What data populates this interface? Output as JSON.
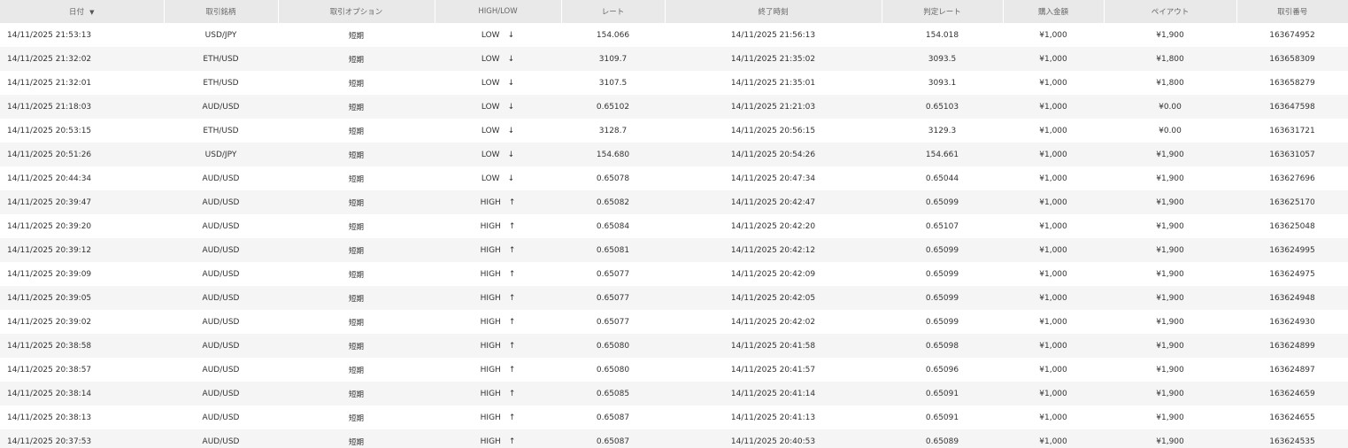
{
  "table": {
    "headers": {
      "date": "日付",
      "symbol": "取引銘柄",
      "option": "取引オプション",
      "direction": "HIGH/LOW",
      "rate": "レート",
      "end_time": "終了時刻",
      "judge_rate": "判定レート",
      "amount": "購入金額",
      "payout": "ペイアウト",
      "trade_no": "取引番号"
    },
    "sort_icon": "caret-down-icon",
    "colors": {
      "low": "#d9263c",
      "high": "#3fb62e",
      "payout_win": "#3fb62e",
      "payout_loss": "#d9263c",
      "header_bg": "#e9e9e9",
      "row_alt_bg": "#f5f5f5"
    },
    "rows": [
      {
        "date": "14/11/2025 21:53:13",
        "symbol": "USD/JPY",
        "option": "短期",
        "direction": "LOW",
        "arrow": "↓",
        "rate": "154.066",
        "end_time": "14/11/2025 21:56:13",
        "judge_rate": "154.018",
        "amount": "¥1,000",
        "payout": "¥1,900",
        "result": "win",
        "trade_no": "163674952"
      },
      {
        "date": "14/11/2025 21:32:02",
        "symbol": "ETH/USD",
        "option": "短期",
        "direction": "LOW",
        "arrow": "↓",
        "rate": "3109.7",
        "end_time": "14/11/2025 21:35:02",
        "judge_rate": "3093.5",
        "amount": "¥1,000",
        "payout": "¥1,800",
        "result": "win",
        "trade_no": "163658309"
      },
      {
        "date": "14/11/2025 21:32:01",
        "symbol": "ETH/USD",
        "option": "短期",
        "direction": "LOW",
        "arrow": "↓",
        "rate": "3107.5",
        "end_time": "14/11/2025 21:35:01",
        "judge_rate": "3093.1",
        "amount": "¥1,000",
        "payout": "¥1,800",
        "result": "win",
        "trade_no": "163658279"
      },
      {
        "date": "14/11/2025 21:18:03",
        "symbol": "AUD/USD",
        "option": "短期",
        "direction": "LOW",
        "arrow": "↓",
        "rate": "0.65102",
        "end_time": "14/11/2025 21:21:03",
        "judge_rate": "0.65103",
        "amount": "¥1,000",
        "payout": "¥0.00",
        "result": "loss",
        "trade_no": "163647598"
      },
      {
        "date": "14/11/2025 20:53:15",
        "symbol": "ETH/USD",
        "option": "短期",
        "direction": "LOW",
        "arrow": "↓",
        "rate": "3128.7",
        "end_time": "14/11/2025 20:56:15",
        "judge_rate": "3129.3",
        "amount": "¥1,000",
        "payout": "¥0.00",
        "result": "loss",
        "trade_no": "163631721"
      },
      {
        "date": "14/11/2025 20:51:26",
        "symbol": "USD/JPY",
        "option": "短期",
        "direction": "LOW",
        "arrow": "↓",
        "rate": "154.680",
        "end_time": "14/11/2025 20:54:26",
        "judge_rate": "154.661",
        "amount": "¥1,000",
        "payout": "¥1,900",
        "result": "win",
        "trade_no": "163631057"
      },
      {
        "date": "14/11/2025 20:44:34",
        "symbol": "AUD/USD",
        "option": "短期",
        "direction": "LOW",
        "arrow": "↓",
        "rate": "0.65078",
        "end_time": "14/11/2025 20:47:34",
        "judge_rate": "0.65044",
        "amount": "¥1,000",
        "payout": "¥1,900",
        "result": "win",
        "trade_no": "163627696"
      },
      {
        "date": "14/11/2025 20:39:47",
        "symbol": "AUD/USD",
        "option": "短期",
        "direction": "HIGH",
        "arrow": "↑",
        "rate": "0.65082",
        "end_time": "14/11/2025 20:42:47",
        "judge_rate": "0.65099",
        "amount": "¥1,000",
        "payout": "¥1,900",
        "result": "win",
        "trade_no": "163625170"
      },
      {
        "date": "14/11/2025 20:39:20",
        "symbol": "AUD/USD",
        "option": "短期",
        "direction": "HIGH",
        "arrow": "↑",
        "rate": "0.65084",
        "end_time": "14/11/2025 20:42:20",
        "judge_rate": "0.65107",
        "amount": "¥1,000",
        "payout": "¥1,900",
        "result": "win",
        "trade_no": "163625048"
      },
      {
        "date": "14/11/2025 20:39:12",
        "symbol": "AUD/USD",
        "option": "短期",
        "direction": "HIGH",
        "arrow": "↑",
        "rate": "0.65081",
        "end_time": "14/11/2025 20:42:12",
        "judge_rate": "0.65099",
        "amount": "¥1,000",
        "payout": "¥1,900",
        "result": "win",
        "trade_no": "163624995"
      },
      {
        "date": "14/11/2025 20:39:09",
        "symbol": "AUD/USD",
        "option": "短期",
        "direction": "HIGH",
        "arrow": "↑",
        "rate": "0.65077",
        "end_time": "14/11/2025 20:42:09",
        "judge_rate": "0.65099",
        "amount": "¥1,000",
        "payout": "¥1,900",
        "result": "win",
        "trade_no": "163624975"
      },
      {
        "date": "14/11/2025 20:39:05",
        "symbol": "AUD/USD",
        "option": "短期",
        "direction": "HIGH",
        "arrow": "↑",
        "rate": "0.65077",
        "end_time": "14/11/2025 20:42:05",
        "judge_rate": "0.65099",
        "amount": "¥1,000",
        "payout": "¥1,900",
        "result": "win",
        "trade_no": "163624948"
      },
      {
        "date": "14/11/2025 20:39:02",
        "symbol": "AUD/USD",
        "option": "短期",
        "direction": "HIGH",
        "arrow": "↑",
        "rate": "0.65077",
        "end_time": "14/11/2025 20:42:02",
        "judge_rate": "0.65099",
        "amount": "¥1,000",
        "payout": "¥1,900",
        "result": "win",
        "trade_no": "163624930"
      },
      {
        "date": "14/11/2025 20:38:58",
        "symbol": "AUD/USD",
        "option": "短期",
        "direction": "HIGH",
        "arrow": "↑",
        "rate": "0.65080",
        "end_time": "14/11/2025 20:41:58",
        "judge_rate": "0.65098",
        "amount": "¥1,000",
        "payout": "¥1,900",
        "result": "win",
        "trade_no": "163624899"
      },
      {
        "date": "14/11/2025 20:38:57",
        "symbol": "AUD/USD",
        "option": "短期",
        "direction": "HIGH",
        "arrow": "↑",
        "rate": "0.65080",
        "end_time": "14/11/2025 20:41:57",
        "judge_rate": "0.65096",
        "amount": "¥1,000",
        "payout": "¥1,900",
        "result": "win",
        "trade_no": "163624897"
      },
      {
        "date": "14/11/2025 20:38:14",
        "symbol": "AUD/USD",
        "option": "短期",
        "direction": "HIGH",
        "arrow": "↑",
        "rate": "0.65085",
        "end_time": "14/11/2025 20:41:14",
        "judge_rate": "0.65091",
        "amount": "¥1,000",
        "payout": "¥1,900",
        "result": "win",
        "trade_no": "163624659"
      },
      {
        "date": "14/11/2025 20:38:13",
        "symbol": "AUD/USD",
        "option": "短期",
        "direction": "HIGH",
        "arrow": "↑",
        "rate": "0.65087",
        "end_time": "14/11/2025 20:41:13",
        "judge_rate": "0.65091",
        "amount": "¥1,000",
        "payout": "¥1,900",
        "result": "win",
        "trade_no": "163624655"
      },
      {
        "date": "14/11/2025 20:37:53",
        "symbol": "AUD/USD",
        "option": "短期",
        "direction": "HIGH",
        "arrow": "↑",
        "rate": "0.65087",
        "end_time": "14/11/2025 20:40:53",
        "judge_rate": "0.65089",
        "amount": "¥1,000",
        "payout": "¥1,900",
        "result": "win",
        "trade_no": "163624535"
      }
    ]
  }
}
